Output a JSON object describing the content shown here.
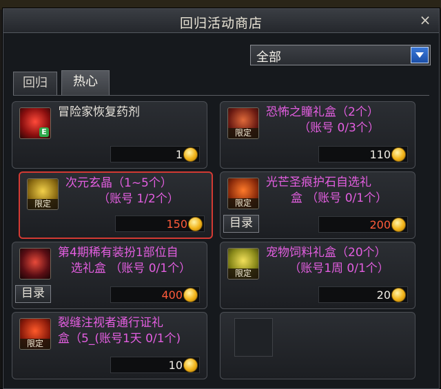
{
  "window": {
    "title": "回归活动商店",
    "close_glyph": "×"
  },
  "filter": {
    "selected": "全部"
  },
  "tabs": [
    {
      "label": "回归"
    },
    {
      "label": "热心"
    }
  ],
  "items": [
    {
      "name_line1": "冒险家恢复药剂",
      "name_line2": "",
      "price": "1",
      "limited": false,
      "limited_label": "",
      "catalog": false,
      "catalog_label": "",
      "highlighted": false
    },
    {
      "name_line1": "恐怖之瞳礼盒（2个）",
      "name_line2": "（账号 0/3个）",
      "price": "110",
      "limited": true,
      "limited_label": "限定",
      "catalog": false,
      "catalog_label": "",
      "highlighted": false
    },
    {
      "name_line1": "次元玄晶（1~5个）",
      "name_line2": "（账号 1/2个）",
      "price": "150",
      "limited": true,
      "limited_label": "限定",
      "catalog": false,
      "catalog_label": "",
      "highlighted": true
    },
    {
      "name_line1": "光芒圣痕护石自选礼",
      "name_line2": "盒 （账号 0/1个）",
      "price": "200",
      "limited": true,
      "limited_label": "限定",
      "catalog": true,
      "catalog_label": "目录",
      "highlighted": false
    },
    {
      "name_line1": "第4期稀有装扮1部位自",
      "name_line2": "选礼盒 （账号 0/1个）",
      "price": "400",
      "limited": false,
      "limited_label": "",
      "catalog": true,
      "catalog_label": "目录",
      "highlighted": false
    },
    {
      "name_line1": "宠物饲料礼盒（20个）",
      "name_line2": "（账号1周 0/1个）",
      "price": "20",
      "limited": true,
      "limited_label": "限定",
      "catalog": false,
      "catalog_label": "",
      "highlighted": false
    },
    {
      "name_line1": "裂缝注视者通行证礼",
      "name_line2": "盒（5_(账号1天 0/1个)",
      "price": "10",
      "limited": true,
      "limited_label": "限定",
      "catalog": false,
      "catalog_label": "",
      "highlighted": false
    }
  ],
  "colors": {
    "name_magenta": "#e35ee0",
    "price_red": "#ff5b3a",
    "highlight_border": "#d43a33"
  }
}
